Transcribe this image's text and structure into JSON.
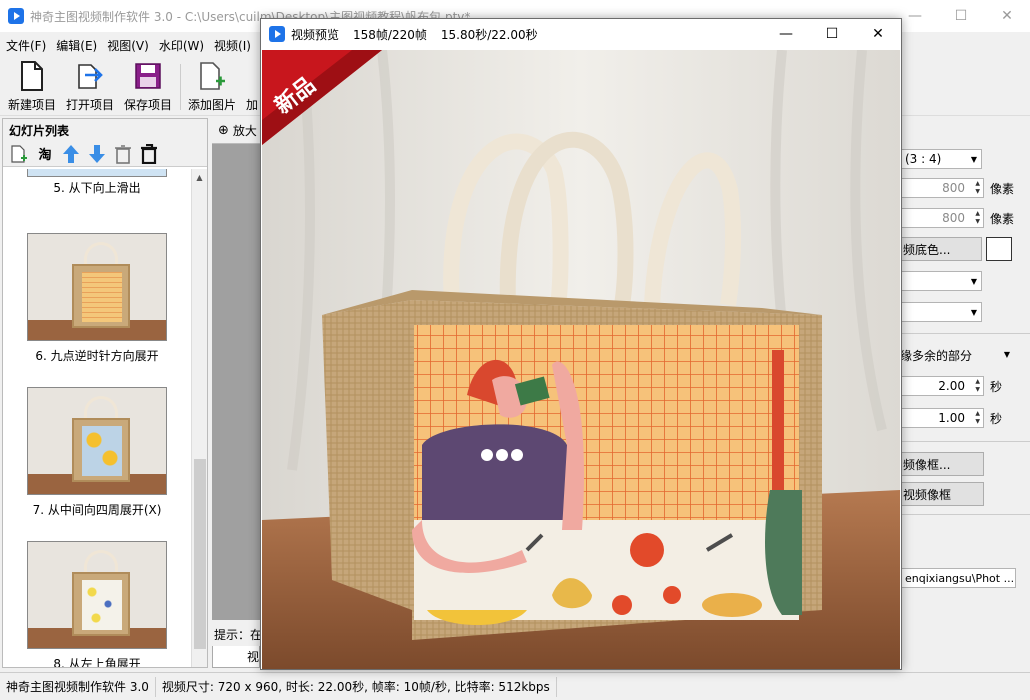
{
  "main_window": {
    "title": "神奇主图视频制作软件 3.0 - C:\\Users\\cuilm\\Desktop\\主图视频教程\\帆布包.ptv*",
    "minimize": "—",
    "maximize": "☐",
    "close": "✕"
  },
  "menu": [
    "文件(F)",
    "编辑(E)",
    "视图(V)",
    "水印(W)",
    "视频(I)"
  ],
  "toolbar": {
    "new_project": "新建项目",
    "open_project": "打开项目",
    "save_project": "保存项目",
    "add_image": "添加图片",
    "add_more": "加"
  },
  "slides_panel": {
    "title": "幻灯片列表",
    "taobao_label": "淘",
    "slides": [
      {
        "label": "5. 从下向上滑出"
      },
      {
        "label": "6. 九点逆时针方向展开"
      },
      {
        "label": "7. 从中间向四周展开(X)"
      },
      {
        "label": "8. 从左上角展开"
      }
    ]
  },
  "center": {
    "zoom_label": "放大",
    "hint": "提示：在",
    "bottom_tab": "视"
  },
  "right_panel": {
    "ratio": "(3 : 4)",
    "width_value": "800",
    "height_value": "800",
    "pixel_unit": "像素",
    "bg_color_button": "频底色...",
    "crop_option": "缘多余的部分",
    "duration_1": "2.00",
    "duration_2": "1.00",
    "seconds_unit": "秒",
    "frame_button_1": "频像框...",
    "frame_button_2": "视频像框",
    "path_value": "enqixiangsu\\Phot ..."
  },
  "statusbar": {
    "app_name": "神奇主图视频制作软件 3.0",
    "info": "视频尺寸: 720 x 960, 时长: 22.00秒, 帧率: 10帧/秒, 比特率: 512kbps"
  },
  "preview_window": {
    "title": "视频预览",
    "frames": "158帧/220帧",
    "time": "15.80秒/22.00秒",
    "minimize": "—",
    "maximize": "☐",
    "close": "✕",
    "badge_text": "新品",
    "badge_color": "#c8161d"
  }
}
